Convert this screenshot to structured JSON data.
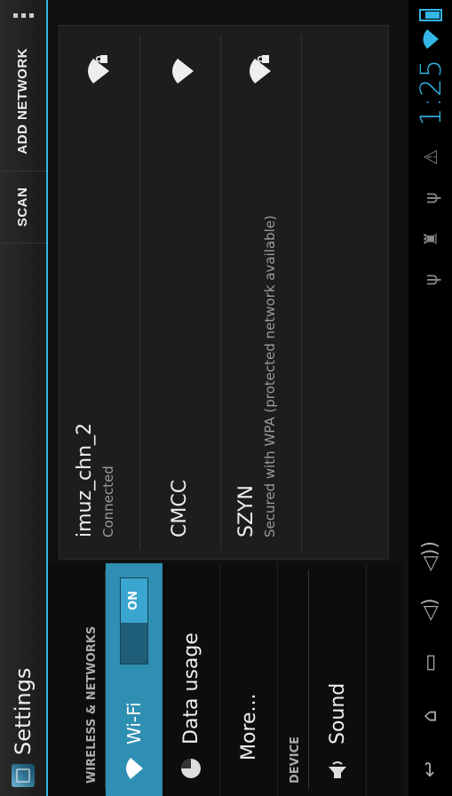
{
  "action_bar": {
    "title": "Settings",
    "scan_label": "SCAN",
    "add_network_label": "ADD NETWORK",
    "icons": [
      "settings-app-icon",
      "overflow-menu-icon"
    ]
  },
  "sidebar": {
    "sections": [
      {
        "header": "WIRELESS & NETWORKS"
      },
      {
        "header": "DEVICE"
      }
    ],
    "items": [
      {
        "label": "Wi-Fi",
        "icon": "wifi-icon",
        "toggle": "ON",
        "selected": true
      },
      {
        "label": "Data usage",
        "icon": "data-usage-icon"
      },
      {
        "label": "More...",
        "icon": ""
      },
      {
        "label": "Sound",
        "icon": "speaker-icon"
      }
    ]
  },
  "networks": [
    {
      "ssid": "imuz_chn_2",
      "status": "Connected",
      "secured": true
    },
    {
      "ssid": "CMCC",
      "status": "",
      "secured": false
    },
    {
      "ssid": "SZYN",
      "status": "Secured with WPA (protected network available)",
      "secured": true
    }
  ],
  "system_bar": {
    "clock": "1:25",
    "nav_icons": [
      "back-icon",
      "home-icon",
      "recent-apps-icon",
      "volume-down-icon",
      "volume-up-icon"
    ],
    "notification_icons": [
      "usb-icon",
      "android-debug-icon",
      "usb-icon",
      "warning-icon"
    ],
    "accent_color": "#33b5e5"
  }
}
